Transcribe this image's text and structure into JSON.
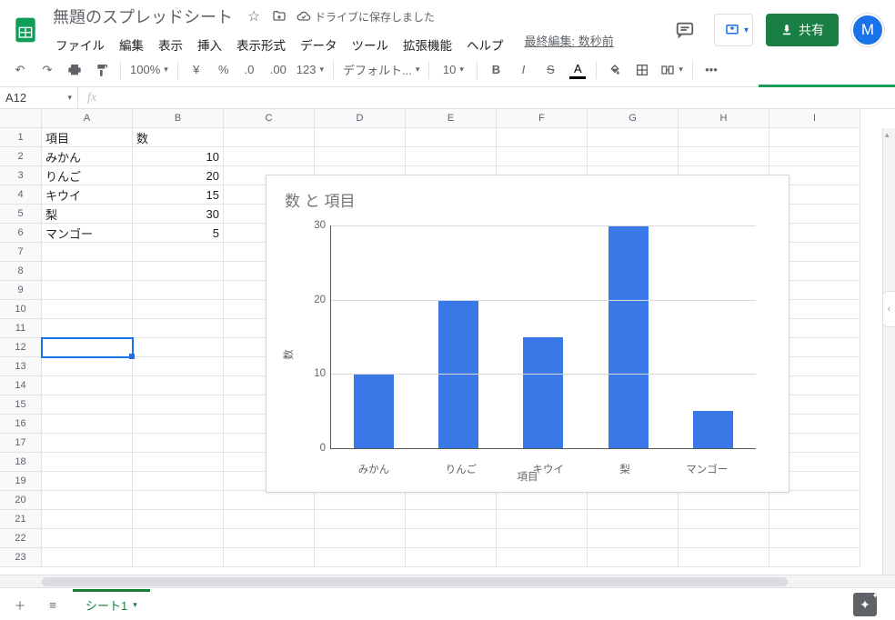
{
  "header": {
    "doc_title": "無題のスプレッドシート",
    "save_status": "ドライブに保存しました",
    "last_edit": "最終編集: 数秒前",
    "share_label": "共有",
    "avatar_letter": "M"
  },
  "menus": [
    "ファイル",
    "編集",
    "表示",
    "挿入",
    "表示形式",
    "データ",
    "ツール",
    "拡張機能",
    "ヘルプ"
  ],
  "toolbar": {
    "zoom": "100%",
    "font": "デフォルト...",
    "font_size": "10",
    "number_fmt": "123"
  },
  "namebox": "A12",
  "columns": [
    "A",
    "B",
    "C",
    "D",
    "E",
    "F",
    "G",
    "H",
    "I"
  ],
  "rows": 23,
  "chart_data": {
    "type": "bar",
    "title": "数 と 項目",
    "ylabel": "数",
    "xlabel": "項目",
    "yticks": [
      0,
      10,
      20,
      30
    ],
    "ylim": [
      0,
      30
    ],
    "categories": [
      "みかん",
      "りんご",
      "キウイ",
      "梨",
      "マンゴー"
    ],
    "values": [
      10,
      20,
      15,
      30,
      5
    ]
  },
  "spreadsheet": {
    "headers": {
      "A": "項目",
      "B": "数"
    },
    "rows": [
      {
        "A": "みかん",
        "B": 10
      },
      {
        "A": "りんご",
        "B": 20
      },
      {
        "A": "キウイ",
        "B": 15
      },
      {
        "A": "梨",
        "B": 30
      },
      {
        "A": "マンゴー",
        "B": 5
      }
    ]
  },
  "sheet_tab": "シート1"
}
